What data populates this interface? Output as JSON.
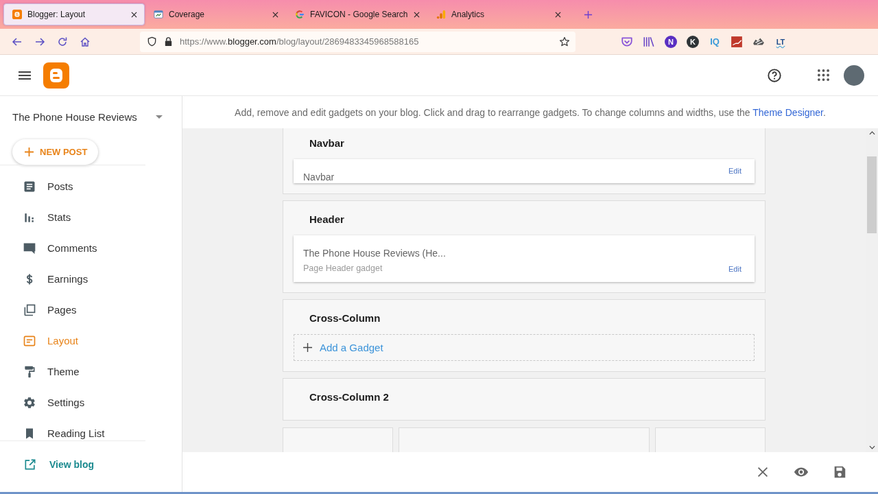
{
  "browser": {
    "tabs": [
      {
        "title": "Blogger: Layout",
        "selected": true
      },
      {
        "title": "Coverage",
        "selected": false
      },
      {
        "title": "FAVICON - Google Search",
        "selected": false
      },
      {
        "title": "Analytics",
        "selected": false
      }
    ],
    "url": {
      "scheme": "https://www.",
      "domain": "blogger.com",
      "path": "/blog/layout/2869483345968588165"
    },
    "extensions": [
      {
        "kind": "pocket"
      },
      {
        "kind": "library"
      },
      {
        "kind": "badge",
        "label": "N",
        "color": "#5a2fc2"
      },
      {
        "kind": "badge",
        "label": "K",
        "color": "#2f3437"
      },
      {
        "kind": "text",
        "label": "IQ"
      },
      {
        "kind": "chart"
      },
      {
        "kind": "shoe"
      },
      {
        "kind": "wave",
        "label": "LT"
      }
    ]
  },
  "sidebar": {
    "blog_name": "The Phone House Reviews",
    "new_post": "NEW POST",
    "items": [
      {
        "label": "Posts",
        "selected": false
      },
      {
        "label": "Stats",
        "selected": false
      },
      {
        "label": "Comments",
        "selected": false
      },
      {
        "label": "Earnings",
        "selected": false
      },
      {
        "label": "Pages",
        "selected": false
      },
      {
        "label": "Layout",
        "selected": true
      },
      {
        "label": "Theme",
        "selected": false
      },
      {
        "label": "Settings",
        "selected": false
      },
      {
        "label": "Reading List",
        "selected": false
      }
    ],
    "view_blog": "View blog"
  },
  "instructions": {
    "text": "Add, remove and edit gadgets on your blog. Click and drag to rearrange gadgets. To change columns and widths, use the",
    "link": "Theme Designer",
    "end": "."
  },
  "sections": [
    {
      "title": "Navbar",
      "gadgets": [
        {
          "title": "Navbar",
          "edit": "Edit"
        }
      ]
    },
    {
      "title": "Header",
      "gadgets": [
        {
          "title": "The Phone House Reviews (He...",
          "subtitle": "Page Header gadget",
          "edit": "Edit"
        }
      ]
    },
    {
      "title": "Cross-Column",
      "add_gadget": "Add a Gadget"
    },
    {
      "title": "Cross-Column 2"
    }
  ],
  "columns": [
    {
      "kind": "narrow"
    },
    {
      "kind": "wide"
    },
    {
      "kind": "narrow"
    }
  ]
}
